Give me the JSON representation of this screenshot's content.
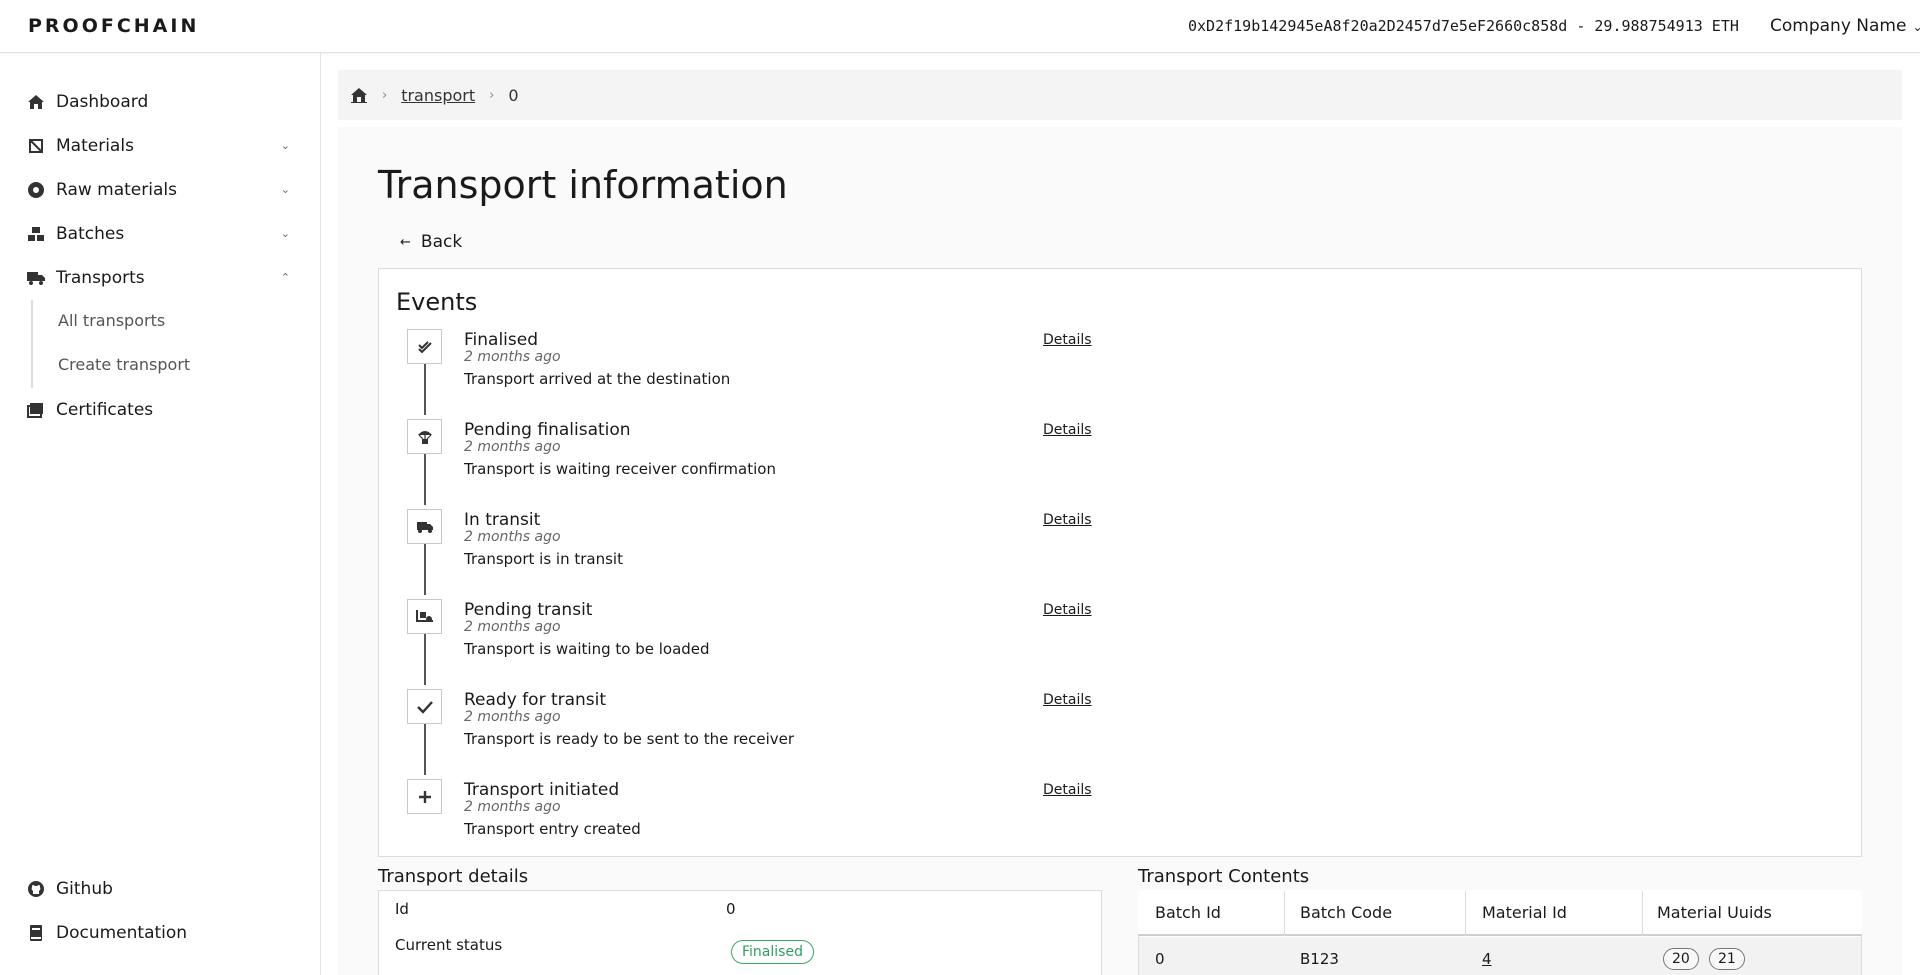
{
  "header": {
    "logo": "PROOFCHAIN",
    "wallet": "0xD2f19b142945eA8f20a2D2457d7e5eF2660c858d - 29.988754913 ETH",
    "company": "Company Name"
  },
  "sidebar": {
    "items": [
      {
        "label": "Dashboard",
        "icon": "home-icon"
      },
      {
        "label": "Materials",
        "icon": "materials-icon"
      },
      {
        "label": "Raw materials",
        "icon": "circle-icon"
      },
      {
        "label": "Batches",
        "icon": "boxes-icon"
      },
      {
        "label": "Transports",
        "icon": "truck-icon"
      },
      {
        "label": "Certificates",
        "icon": "certificate-icon"
      }
    ],
    "transport_sub": [
      "All transports",
      "Create transport"
    ],
    "footer": [
      {
        "label": "Github",
        "icon": "github-icon"
      },
      {
        "label": "Documentation",
        "icon": "book-icon"
      }
    ]
  },
  "breadcrumb": {
    "link": "transport",
    "current": "0"
  },
  "page": {
    "title": "Transport information",
    "back": "Back"
  },
  "events": {
    "title": "Events",
    "details_label": "Details",
    "items": [
      {
        "title": "Finalised",
        "time": "2 months ago",
        "desc": "Transport arrived at the destination",
        "icon": "double-check-icon"
      },
      {
        "title": "Pending finalisation",
        "time": "2 months ago",
        "desc": "Transport is waiting receiver confirmation",
        "icon": "parachute-box-icon"
      },
      {
        "title": "In transit",
        "time": "2 months ago",
        "desc": "Transport is in transit",
        "icon": "truck-icon"
      },
      {
        "title": "Pending transit",
        "time": "2 months ago",
        "desc": "Transport is waiting to be loaded",
        "icon": "truck-loading-icon"
      },
      {
        "title": "Ready for transit",
        "time": "2 months ago",
        "desc": "Transport is ready to be sent to the receiver",
        "icon": "check-icon"
      },
      {
        "title": "Transport initiated",
        "time": "2 months ago",
        "desc": "Transport entry created",
        "icon": "plus-icon"
      }
    ]
  },
  "transport_details": {
    "title": "Transport details",
    "id_label": "Id",
    "id_value": "0",
    "status_label": "Current status",
    "status_value": "Finalised",
    "status_color": "#2f9e62"
  },
  "transport_contents": {
    "title": "Transport Contents",
    "columns": [
      "Batch Id",
      "Batch Code",
      "Material Id",
      "Material Uuids"
    ],
    "rows": [
      {
        "batch_id": "0",
        "batch_code": "B123",
        "material_id": "4",
        "uuids": [
          "20",
          "21"
        ]
      }
    ]
  }
}
